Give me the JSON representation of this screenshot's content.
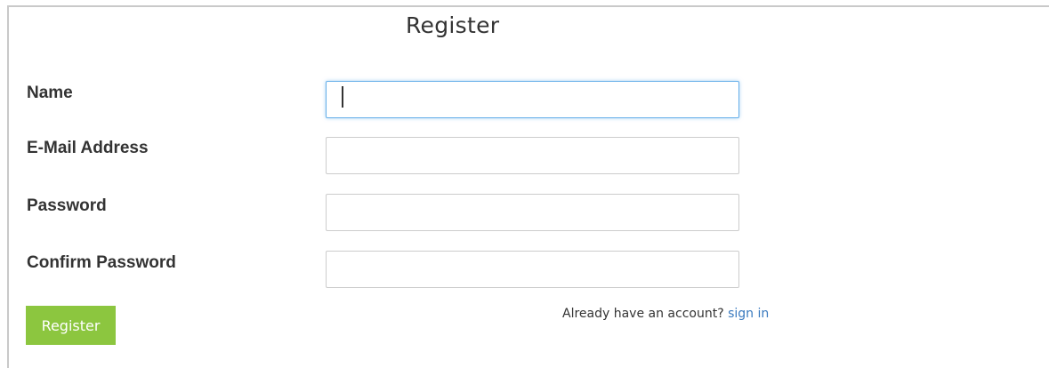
{
  "form": {
    "title": "Register",
    "fields": [
      {
        "label": "Name",
        "value": "",
        "focused": true
      },
      {
        "label": "E-Mail Address",
        "value": ""
      },
      {
        "label": "Password",
        "value": ""
      },
      {
        "label": "Confirm Password",
        "value": ""
      }
    ],
    "submit_label": "Register",
    "signin_prompt": "Already have an account?",
    "signin_link": "sign in"
  },
  "colors": {
    "button": "#8cc63f",
    "link": "#3a7abf",
    "focus_border": "#66afe9"
  }
}
